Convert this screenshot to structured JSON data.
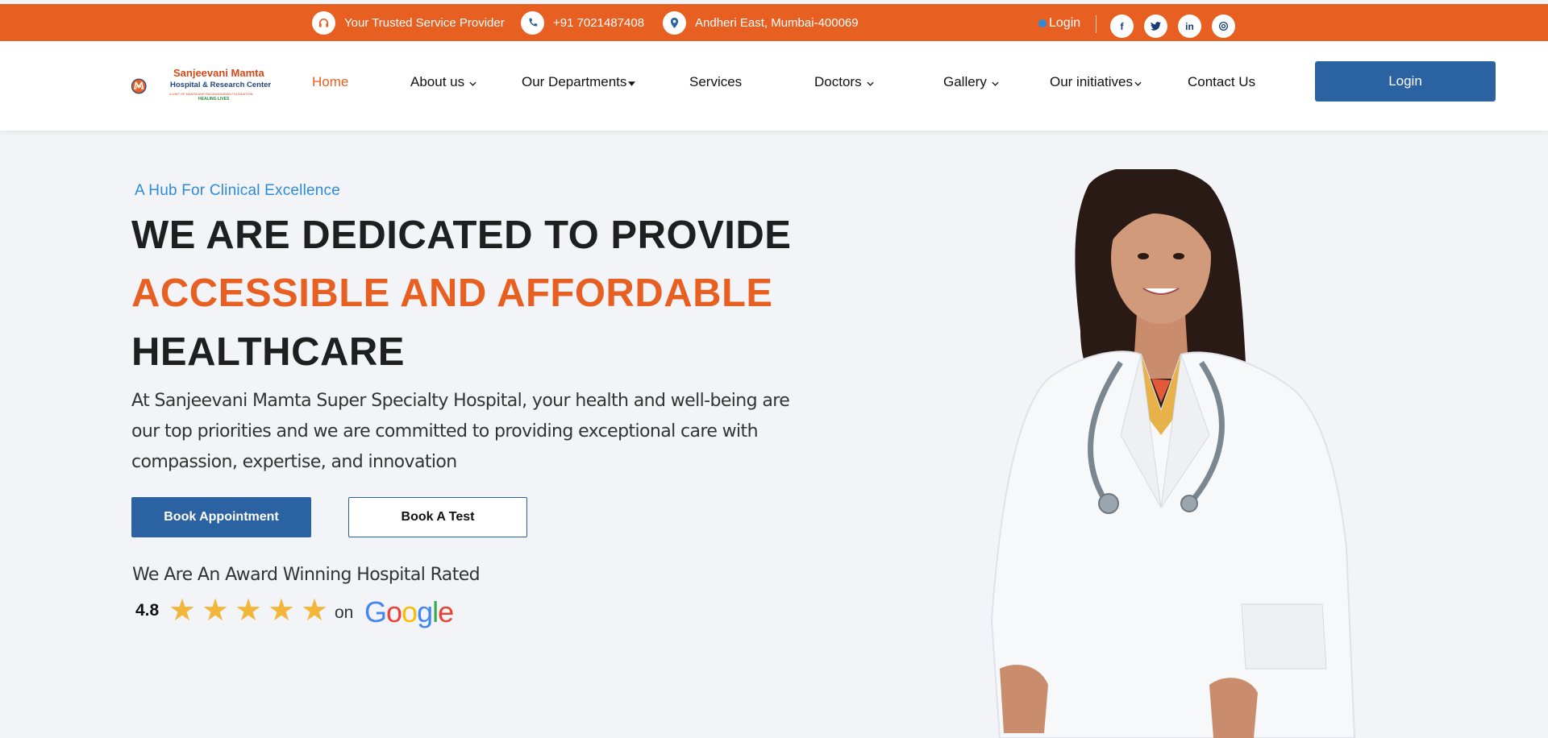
{
  "topbar": {
    "items": [
      {
        "icon": "headset-icon",
        "text": "Your Trusted Service Provider"
      },
      {
        "icon": "phone-icon",
        "text": "+91 7021487408"
      },
      {
        "icon": "location-pin-icon",
        "text": "Andheri East, Mumbai-400069"
      }
    ],
    "login": "Login",
    "social": [
      "facebook-icon",
      "twitter-icon",
      "linkedin-icon",
      "threads-icon"
    ]
  },
  "logo": {
    "line1": "Sanjeevani Mamta",
    "line2": "Hospital & Research Center",
    "line3": "A UNIT OF MAMTA AND RAGHUNANDAN FOUNDATION",
    "line4": "HEALING LIVES"
  },
  "nav": {
    "items": [
      "Home",
      "About us",
      "Our Departments",
      "Services",
      "Doctors",
      "Gallery",
      "Our initiatives",
      "Contact Us"
    ],
    "login": "Login"
  },
  "hero": {
    "tagline": "A Hub For Clinical Excellence",
    "heading1": "WE ARE DEDICATED TO PROVIDE",
    "heading2": "ACCESSIBLE AND AFFORDABLE",
    "heading3": "HEALTHCARE",
    "description": "At Sanjeevani Mamta Super Specialty Hospital, your health and well-being are our top priorities and we are committed to providing exceptional care with compassion, expertise, and innovation",
    "book_appointment": "Book Appointment",
    "book_test": "Book A Test",
    "award_text": "We Are An Award Winning Hospital Rated",
    "rating": "4.8",
    "stars": 5,
    "on": "on",
    "google": "Google"
  },
  "colors": {
    "brand_orange": "#e85f22",
    "brand_blue": "#2a62a2",
    "tagline_blue": "#2e8bd8",
    "star_gold": "#f2b73a"
  }
}
